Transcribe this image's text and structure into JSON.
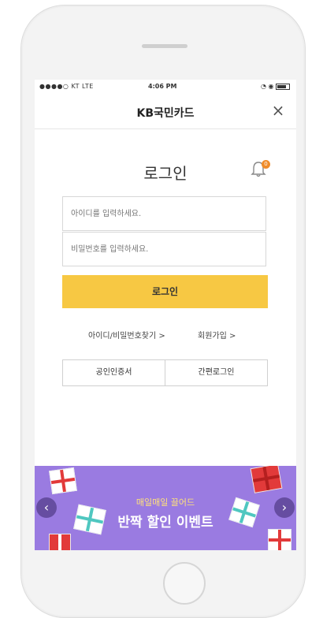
{
  "status_bar": {
    "carrier": "●●●●○ KT LTE",
    "time": "4:06 PM"
  },
  "header": {
    "title": "KB국민카드",
    "close_label": "×"
  },
  "login": {
    "heading": "로그인",
    "notification_count": "0",
    "id_placeholder": "아이디를 입력하세요.",
    "password_placeholder": "비밀번호를 입력하세요.",
    "button_label": "로그인",
    "find_link": "아이디/비밀번호찾기 >",
    "join_link": "회원가입 >",
    "cert_button": "공인인증서",
    "simple_login_button": "간편로그인"
  },
  "banner": {
    "subtitle": "매일매일 끌어드",
    "title": "반짝 할인 이벤트",
    "prev_label": "‹",
    "next_label": "›"
  },
  "colors": {
    "accent_yellow": "#f7c843",
    "banner_purple": "#9a7be1",
    "badge_orange": "#f08c2a"
  },
  "icons": [
    "close-icon",
    "bell-icon",
    "battery-icon",
    "gift-icon",
    "chevron-left-icon",
    "chevron-right-icon"
  ]
}
